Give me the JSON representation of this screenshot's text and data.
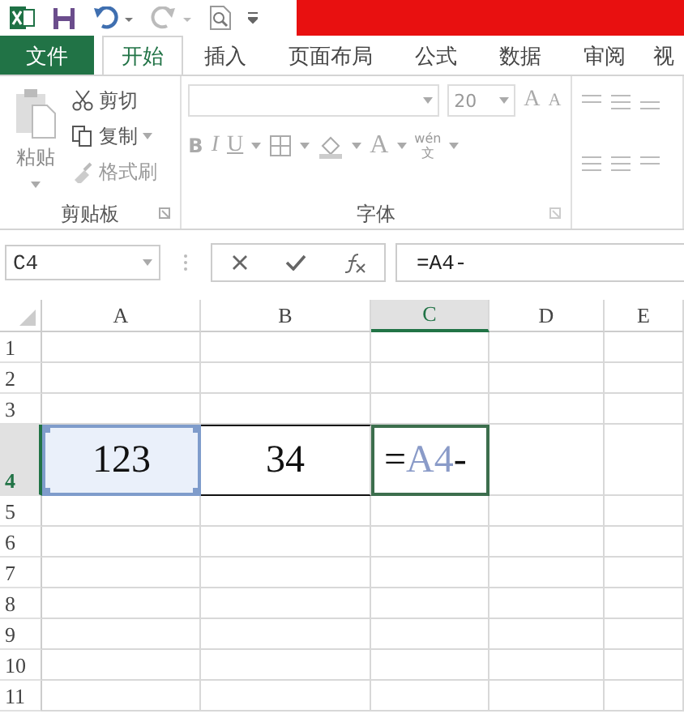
{
  "ribbon_tabs": [
    {
      "label": "文件",
      "kind": "file",
      "selected": false
    },
    {
      "label": "开始",
      "kind": "tab",
      "selected": true
    },
    {
      "label": "插入",
      "kind": "tab",
      "selected": false
    },
    {
      "label": "页面布局",
      "kind": "tab",
      "selected": false
    },
    {
      "label": "公式",
      "kind": "tab",
      "selected": false
    },
    {
      "label": "数据",
      "kind": "tab",
      "selected": false
    },
    {
      "label": "审阅",
      "kind": "tab",
      "selected": false
    },
    {
      "label": "视",
      "kind": "tab",
      "selected": false
    }
  ],
  "clipboard_group": {
    "label": "剪贴板",
    "paste": "粘贴",
    "cut": "剪切",
    "copy": "复制",
    "format_painter": "格式刷"
  },
  "font_group": {
    "label": "字体",
    "font_size": "20",
    "grow": "A",
    "shrink": "A",
    "bold": "B",
    "italic": "I",
    "underline": "U",
    "font_color": "A",
    "phonetic_top": "wén",
    "phonetic_bottom": "文"
  },
  "formula_bar": {
    "name_box": "C4",
    "formula": "=A4-"
  },
  "sheet": {
    "columns": [
      {
        "label": "A",
        "selected": false
      },
      {
        "label": "B",
        "selected": false
      },
      {
        "label": "C",
        "selected": true
      },
      {
        "label": "D",
        "selected": false
      },
      {
        "label": "E",
        "selected": false
      }
    ],
    "rows": [
      {
        "label": "1",
        "selected": false,
        "tall": false,
        "cells": []
      },
      {
        "label": "2",
        "selected": false,
        "tall": false,
        "cells": []
      },
      {
        "label": "3",
        "selected": false,
        "tall": false,
        "cells": []
      },
      {
        "label": "4",
        "selected": true,
        "tall": true,
        "cells": [
          {
            "kind": "ref",
            "parts": [
              {
                "text": "123",
                "kind": "plain"
              }
            ]
          },
          {
            "kind": "operand",
            "parts": [
              {
                "text": "34",
                "kind": "plain"
              }
            ]
          },
          {
            "kind": "active",
            "parts": [
              {
                "text": "=",
                "kind": "plain"
              },
              {
                "text": "A4",
                "kind": "ref"
              },
              {
                "text": "-",
                "kind": "plain"
              }
            ]
          }
        ]
      },
      {
        "label": "5",
        "selected": false,
        "tall": false,
        "cells": []
      },
      {
        "label": "6",
        "selected": false,
        "tall": false,
        "cells": []
      },
      {
        "label": "7",
        "selected": false,
        "tall": false,
        "cells": []
      },
      {
        "label": "8",
        "selected": false,
        "tall": false,
        "cells": []
      },
      {
        "label": "9",
        "selected": false,
        "tall": false,
        "cells": []
      },
      {
        "label": "10",
        "selected": false,
        "tall": false,
        "cells": []
      },
      {
        "label": "11",
        "selected": false,
        "tall": false,
        "cells": []
      }
    ]
  }
}
